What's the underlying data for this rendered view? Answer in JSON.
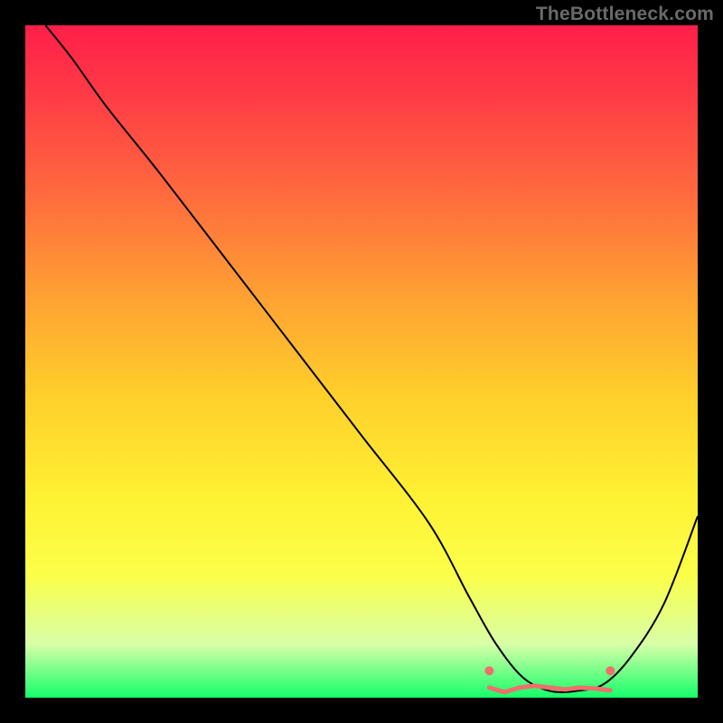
{
  "watermark": "TheBottleneck.com",
  "chart_data": {
    "type": "line",
    "title": "",
    "xlabel": "",
    "ylabel": "",
    "xlim": [
      0,
      100
    ],
    "ylim": [
      0,
      100
    ],
    "series": [
      {
        "name": "curve",
        "x": [
          3,
          7,
          12,
          20,
          30,
          40,
          50,
          60,
          66,
          70,
          74,
          78,
          82,
          86,
          90,
          95,
          100
        ],
        "y": [
          100,
          95,
          88,
          78,
          65,
          52,
          39,
          26,
          15,
          8,
          3,
          1,
          1,
          2,
          6,
          14,
          27
        ]
      }
    ],
    "highlight_band": {
      "x_start": 69,
      "x_end": 87,
      "y": 1.5
    },
    "highlight_points": [
      {
        "x": 69,
        "y": 4
      },
      {
        "x": 87,
        "y": 4
      }
    ],
    "colors": {
      "curve": "#000000",
      "highlight": "#ef6f6c",
      "gradient_top": "#ff1f4a",
      "gradient_bottom": "#16ff6a"
    }
  }
}
